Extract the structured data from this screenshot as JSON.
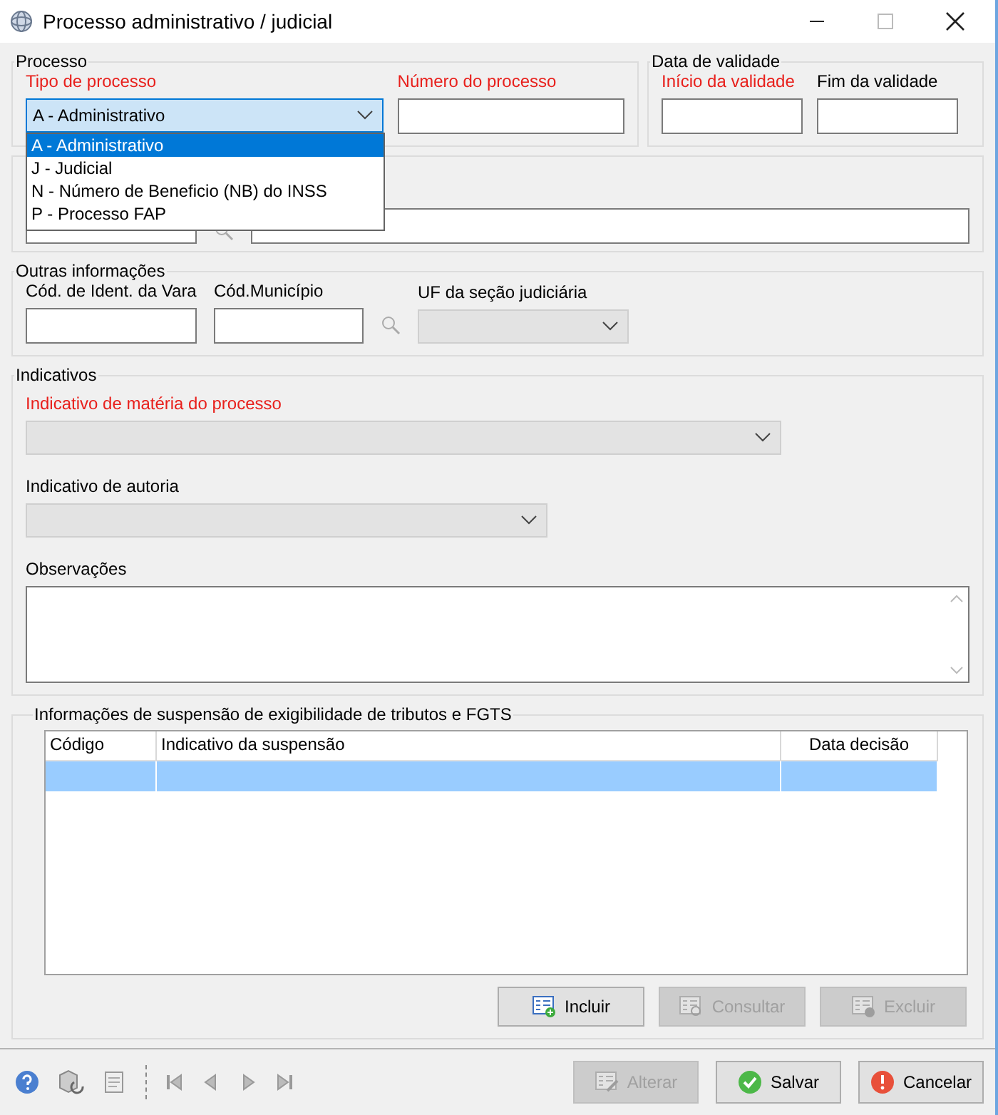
{
  "window": {
    "title": "Processo administrativo / judicial"
  },
  "processo": {
    "legend": "Processo",
    "tipo": {
      "label": "Tipo de processo",
      "required": true,
      "value": "A - Administrativo",
      "expanded": true,
      "options": [
        {
          "label": "A - Administrativo",
          "selected": true
        },
        {
          "label": "J - Judicial",
          "selected": false
        },
        {
          "label": "N - Número de Beneficio (NB) do INSS",
          "selected": false
        },
        {
          "label": "P - Processo FAP",
          "selected": false
        }
      ]
    },
    "numero": {
      "label": "Número do processo",
      "required": true
    }
  },
  "validade": {
    "legend": "Data de validade",
    "fields": [
      {
        "label": "Início da validade",
        "required": true
      },
      {
        "label": "Fim da validade",
        "required": false
      }
    ]
  },
  "outras": {
    "legend": "Outras informações",
    "vara": {
      "label": "Cód. de Ident. da Vara",
      "required": false
    },
    "municipio": {
      "label": "Cód.Município",
      "required": false
    },
    "uf": {
      "label": "UF da seção judiciária",
      "required": false,
      "disabled": true
    }
  },
  "indicativos": {
    "legend": "Indicativos",
    "materia": {
      "label": "Indicativo de matéria do processo",
      "required": true,
      "disabled": true
    },
    "autoria": {
      "label": "Indicativo de autoria",
      "required": false,
      "disabled": true
    },
    "observacoes": {
      "label": "Observações",
      "required": false
    }
  },
  "suspensao": {
    "legend": "Informações de suspensão de exigibilidade de tributos e FGTS",
    "columns": [
      "Código",
      "Indicativo da suspensão",
      "Data decisão"
    ],
    "rows": [
      {
        "selected": true
      }
    ],
    "buttons": [
      {
        "label": "Incluir",
        "kind": "add",
        "disabled": false
      },
      {
        "label": "Consultar",
        "kind": "view",
        "disabled": true
      },
      {
        "label": "Excluir",
        "kind": "remove",
        "disabled": true
      }
    ]
  },
  "footer": {
    "buttons": [
      {
        "label": "Alterar",
        "kind": "edit",
        "disabled": true
      },
      {
        "label": "Salvar",
        "kind": "save",
        "disabled": false
      },
      {
        "label": "Cancelar",
        "kind": "cancel",
        "disabled": false
      }
    ]
  }
}
